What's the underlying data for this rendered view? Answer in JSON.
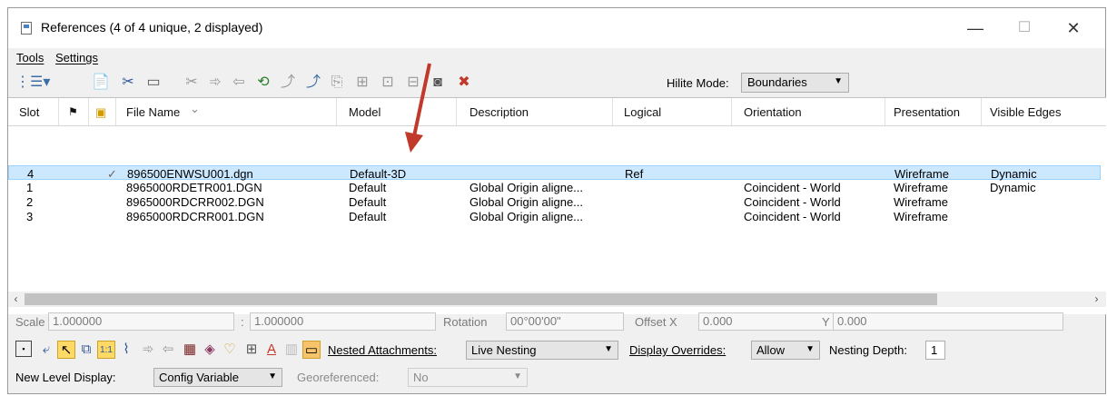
{
  "window": {
    "title": "References (4 of 4 unique, 2 displayed)",
    "minimize": "—",
    "maximize": "☐",
    "close": "✕"
  },
  "menu": {
    "tools": "Tools",
    "settings": "Settings"
  },
  "toolbar": {
    "hilite_label": "Hilite Mode:",
    "hilite_value": "Boundaries",
    "icons": [
      "tree-view-icon",
      "attach-icon",
      "detach-icon",
      "reload-icon",
      "clip-icon",
      "move-icon",
      "copy-icon",
      "scale-icon",
      "rotate-icon",
      "mirror-horizontal-icon",
      "mirror-vertical-icon",
      "clip-boundary-icon",
      "clip-mask-icon",
      "clip-delete-icon",
      "merge-icon",
      "make-direct-icon",
      "exchange-icon",
      "delete-reference-icon"
    ]
  },
  "grid": {
    "headers": [
      "Slot",
      "",
      "",
      "File Name",
      "Model",
      "Description",
      "Logical",
      "Orientation",
      "Presentation",
      "Visible Edges"
    ],
    "rows": [
      {
        "slot": "4",
        "check": "✓",
        "file": "896500ENWSU001.dgn",
        "model": "Default-3D",
        "description": "",
        "logical": "Ref",
        "orientation": "",
        "presentation": "Wireframe",
        "edges": "Dynamic",
        "selected": true
      },
      {
        "slot": "1",
        "check": "",
        "file": "8965000RDETR001.DGN",
        "model": "Default",
        "description": "Global Origin aligne...",
        "logical": "",
        "orientation": "Coincident - World",
        "presentation": "Wireframe",
        "edges": "Dynamic",
        "selected": false
      },
      {
        "slot": "2",
        "check": "",
        "file": "8965000RDCRR002.DGN",
        "model": "Default",
        "description": "Global Origin aligne...",
        "logical": "",
        "orientation": "Coincident - World",
        "presentation": "Wireframe",
        "edges": "",
        "selected": false
      },
      {
        "slot": "3",
        "check": "",
        "file": "8965000RDCRR001.DGN",
        "model": "Default",
        "description": "Global Origin aligne...",
        "logical": "",
        "orientation": "Coincident - World",
        "presentation": "Wireframe",
        "edges": "",
        "selected": false
      }
    ]
  },
  "fields": {
    "scale_label": "Scale",
    "scale1": "1.000000",
    "scale_sep": ":",
    "scale2": "1.000000",
    "rotation_label": "Rotation",
    "rotation": "00°00'00\"",
    "offset_x_label": "Offset X",
    "offset_x": "0.000",
    "offset_y_label": "Y",
    "offset_y": "0.000"
  },
  "bottom": {
    "nested_label": "Nested Attachments:",
    "nested_value": "Live Nesting",
    "overrides_label": "Display Overrides:",
    "overrides_value": "Allow",
    "depth_label": "Nesting Depth:",
    "depth_value": "1",
    "new_level_label": "New Level Display:",
    "new_level_value": "Config Variable",
    "georef_label": "Georeferenced:",
    "georef_value": "No"
  },
  "colors": {
    "accent_arrow": "#c0392b",
    "selection": "#cce8ff"
  }
}
